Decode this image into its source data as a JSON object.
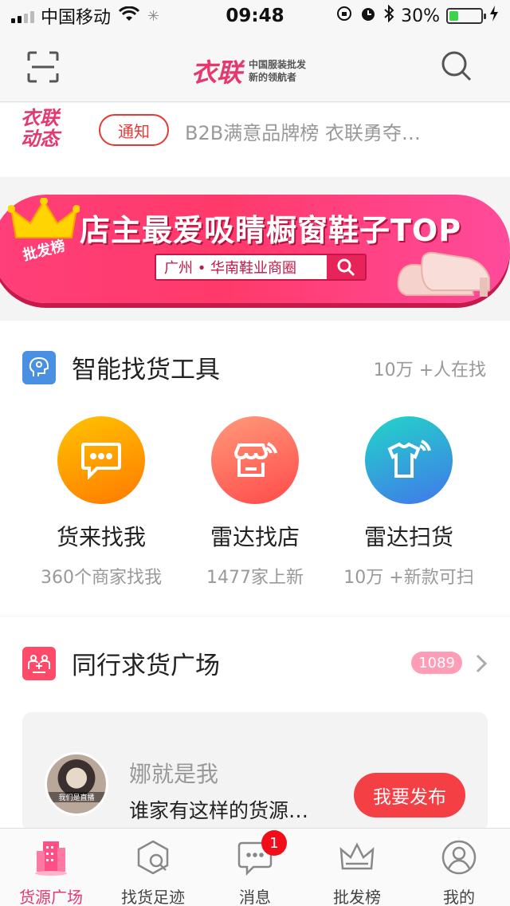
{
  "status_bar": {
    "carrier": "中国移动",
    "time": "09:48",
    "battery": "30%",
    "battery_level": 0.3
  },
  "header": {
    "brand_name": "衣联",
    "brand_tagline_1": "中国服装批发",
    "brand_tagline_2": "新的领航者",
    "scan_icon": "scan-icon",
    "search_icon": "search-icon"
  },
  "news": {
    "logo_line1": "衣联",
    "logo_line2": "动态",
    "badge": "通知",
    "headline": "B2B满意品牌榜 衣联勇夺…"
  },
  "banner": {
    "badge": "批发榜",
    "title": "店主最爱吸睛橱窗鞋子TOP",
    "search_text": "广州 • 华南鞋业商圈"
  },
  "smart_tools": {
    "title": "智能找货工具",
    "subtitle": "10万 +人在找",
    "items": [
      {
        "name": "货来找我",
        "sub": "360个商家找我",
        "icon": "chat-icon",
        "color_from": "#ffb400",
        "color_to": "#ff7a00"
      },
      {
        "name": "雷达找店",
        "sub": "1477家上新",
        "icon": "store-radar-icon",
        "color_from": "#ff8a6a",
        "color_to": "#ff4a4a"
      },
      {
        "name": "雷达扫货",
        "sub": "10万 +新款可扫",
        "icon": "shirt-radar-icon",
        "color_from": "#2ad1c9",
        "color_to": "#3f7fe8"
      }
    ]
  },
  "peer_requests": {
    "title": "同行求货广场",
    "count": "1089",
    "avatar_caption": "我们是直播",
    "poster": "娜就是我",
    "request": "谁家有这样的货源…",
    "publish_label": "我要发布"
  },
  "tabbar": {
    "items": [
      {
        "label": "货源广场",
        "icon": "building-icon",
        "active": true
      },
      {
        "label": "找货足迹",
        "icon": "footprint-search-icon",
        "active": false
      },
      {
        "label": "消息",
        "icon": "message-icon",
        "active": false,
        "badge": "1"
      },
      {
        "label": "批发榜",
        "icon": "crown-icon",
        "active": false
      },
      {
        "label": "我的",
        "icon": "profile-icon",
        "active": false
      }
    ]
  },
  "colors": {
    "brand": "#e5386e",
    "notice": "#e53935",
    "publish": "#f43f45"
  }
}
